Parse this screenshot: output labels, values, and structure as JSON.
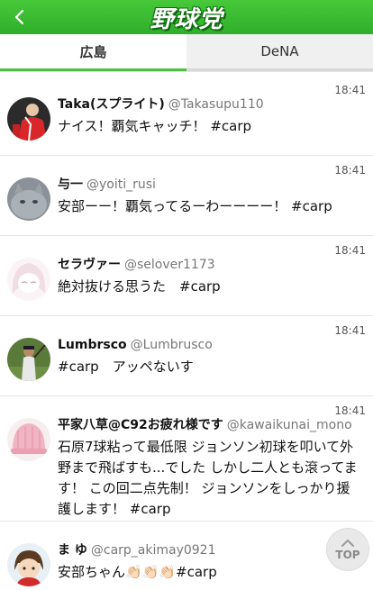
{
  "header": {
    "logo_text": "野球党",
    "back_icon": "chevron-left-icon"
  },
  "tabs": [
    {
      "label": "広島",
      "active": true
    },
    {
      "label": "DeNA",
      "active": false
    }
  ],
  "tweets": [
    {
      "name": "Taka(スプライト)",
      "handle": "@Takasupu110",
      "time": "18:41",
      "text": "ナイス！覇気キャッチ！ #carp",
      "avatar": "baseball-player-red-avatar"
    },
    {
      "name": "与一",
      "handle": "@yoiti_rusi",
      "time": "18:41",
      "text": "安部ーー！覇気ってるーわーーーー！ #carp",
      "avatar": "gray-cat-avatar"
    },
    {
      "name": "セラヴァー",
      "handle": "@selover1173",
      "time": "18:41",
      "text": "絶対抜ける思うた　#carp",
      "avatar": "anime-girl-avatar"
    },
    {
      "name": "Lumbrsco",
      "handle": "@Lumbrusco",
      "time": "18:41",
      "text": "#carp　アッペないす",
      "avatar": "baseball-batter-avatar"
    },
    {
      "name": "平家八草@C92お疲れ様です",
      "handle": "@kawaikunai_mono",
      "time": "18:41",
      "text": "石原7球粘って最低限 ジョンソン初球を叩いて外野まで飛ばすも...でした しかし二人とも滾ってます！ この回二点先制！ ジョンソンをしっかり援護します！ #carp",
      "avatar": "pink-knit-hat-avatar"
    },
    {
      "name": "ま ゆ",
      "handle": "@carp_akimay0921",
      "time": "",
      "text": "安部ちゃん👏🏻👏🏻👏🏻#carp",
      "avatar": "cartoon-girl-avatar"
    }
  ],
  "top_button": {
    "label": "TOP",
    "icon": "chevron-up-icon"
  },
  "colors": {
    "brand_green": "#3fbf33",
    "tab_underline": "#4cc13e"
  }
}
